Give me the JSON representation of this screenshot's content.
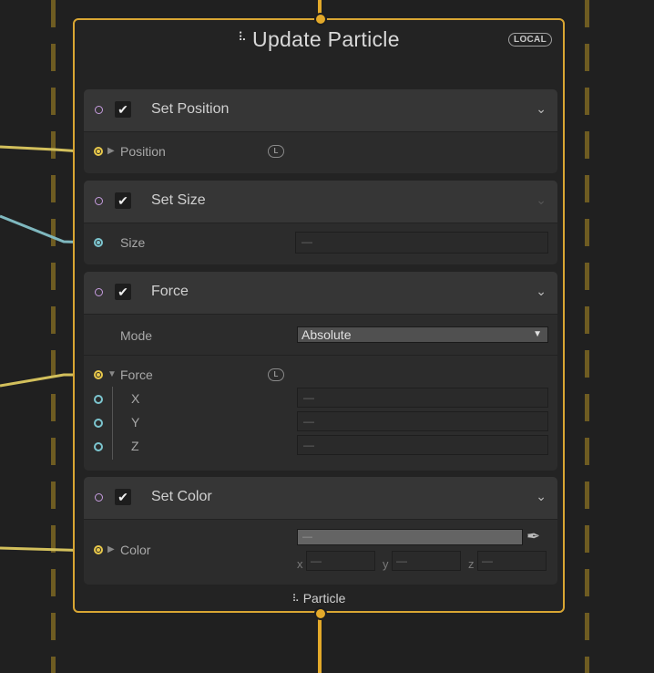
{
  "node": {
    "title": "Update Particle",
    "title_icon": "particle-system-icon",
    "badge": "LOCAL",
    "footer": "Particle"
  },
  "blocks": {
    "set_position": {
      "name": "Set Position",
      "property": "Position",
      "link_badge": "L"
    },
    "set_size": {
      "name": "Set Size",
      "property": "Size",
      "value": "—"
    },
    "force": {
      "name": "Force",
      "mode_label": "Mode",
      "mode_value": "Absolute",
      "property": "Force",
      "link_badge": "L",
      "x_label": "X",
      "x_value": "—",
      "y_label": "Y",
      "y_value": "—",
      "z_label": "Z",
      "z_value": "—"
    },
    "set_color": {
      "name": "Set Color",
      "property": "Color",
      "color_value": "—",
      "x_label": "x",
      "x_value": "—",
      "y_label": "y",
      "y_value": "—",
      "z_label": "z",
      "z_value": "—"
    }
  },
  "glyphs": {
    "check": "✔",
    "chevron": "⌄",
    "expand": "▶",
    "collapse": "▼",
    "dropdown": "▼",
    "eyedropper": "✒",
    "particles": "⠧"
  },
  "colors": {
    "node_border": "#d9a633",
    "flow_wire": "#e3a92a",
    "position_wire": "#d3c05c",
    "size_wire": "#7fb8bf"
  }
}
